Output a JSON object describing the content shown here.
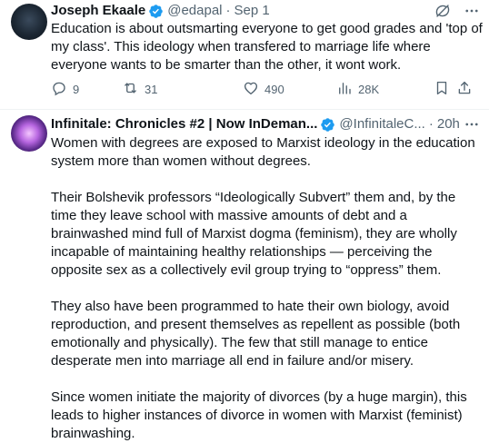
{
  "tweets": [
    {
      "author_name": "Joseph Ekaale",
      "handle": "@edapal",
      "separator": "·",
      "time": "Sep 1",
      "text": "Education is about outsmarting everyone to get good grades and 'top of my class'. This ideology when transfered to marriage life where everyone wants to be smarter than the other, it wont work.",
      "stats": {
        "replies": "9",
        "retweets": "31",
        "likes": "490",
        "views": "28K"
      }
    },
    {
      "author_name": "Infinitale: Chronicles #2 | Now InDeman...",
      "handle": "@InfinitaleC...",
      "separator": "·",
      "time": "20h",
      "paragraphs": [
        "Women with degrees are exposed to Marxist ideology in the education system more than women without degrees.",
        "Their Bolshevik professors “Ideologically Subvert” them and, by the time they leave school with massive amounts of debt and a brainwashed mind full of Marxist dogma (feminism), they are wholly incapable of maintaining healthy relationships — perceiving the opposite sex as a collectively evil group trying to “oppress” them.",
        "They also have been programmed to hate their own biology, avoid reproduction, and present themselves as repellent as possible (both emotionally and physically). The few that still manage to entice desperate men into marriage all end in failure and/or misery.",
        "Since women initiate the majority of divorces (by a huge margin), this leads to higher instances of divorce in women with Marxist (feminist) brainwashing."
      ]
    }
  ],
  "colors": {
    "text": "#0f1419",
    "secondary": "#536471",
    "verified": "#1d9bf0",
    "divider": "#eff3f4"
  },
  "icons": {
    "verified": "verified-badge-icon",
    "grok": "grok-icon",
    "more": "more-icon",
    "reply": "reply-icon",
    "retweet": "retweet-icon",
    "like": "heart-icon",
    "views": "views-icon",
    "bookmark": "bookmark-icon",
    "share": "share-icon"
  }
}
